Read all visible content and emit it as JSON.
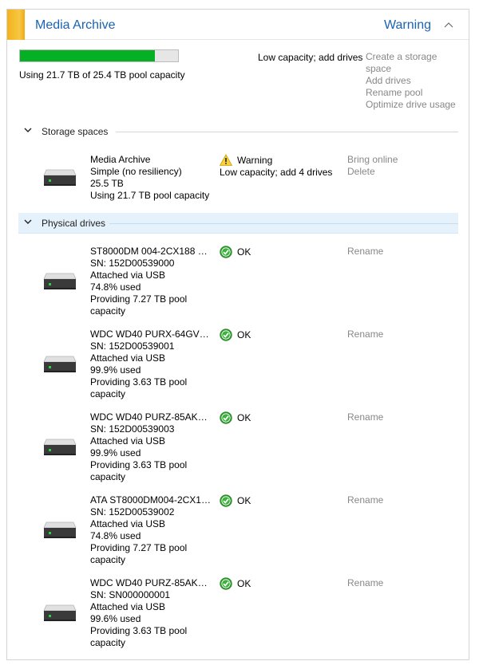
{
  "pool": {
    "title": "Media Archive",
    "status": "Warning",
    "collapse_glyph": "^",
    "usage_fraction": 0.855,
    "usage_text": "Using 21.7 TB of 25.4 TB pool capacity",
    "alert": "Low capacity; add drives",
    "tasks": [
      "Create a storage space",
      "Add drives",
      "Rename pool",
      "Optimize drive usage"
    ]
  },
  "sections": {
    "storage_spaces": "Storage spaces",
    "physical_drives": "Physical drives",
    "chevron_glyph": "⌄"
  },
  "storage_space": {
    "name": "Media Archive",
    "resiliency": "Simple (no resiliency)",
    "size": "25.5 TB",
    "usage": "Using 21.7 TB pool capacity",
    "status": "Warning",
    "status_detail": "Low capacity; add 4 drives",
    "actions": [
      "Bring online",
      "Delete"
    ]
  },
  "drives": [
    {
      "name": "ST8000DM 004-2CX188 SC...",
      "sn": "SN: 152D00539000",
      "attach": "Attached via USB",
      "used": "74.8% used",
      "providing": "Providing 7.27 TB pool capacity",
      "status": "OK",
      "action": "Rename"
    },
    {
      "name": "WDC WD40 PURX-64GVN...",
      "sn": "SN: 152D00539001",
      "attach": "Attached via USB",
      "used": "99.9% used",
      "providing": "Providing 3.63 TB pool capacity",
      "status": "OK",
      "action": "Rename"
    },
    {
      "name": "WDC WD40 PURZ-85AKK...",
      "sn": "SN: 152D00539003",
      "attach": "Attached via USB",
      "used": "99.9% used",
      "providing": "Providing 3.63 TB pool capacity",
      "status": "OK",
      "action": "Rename"
    },
    {
      "name": "ATA ST8000DM004-2CX1 S...",
      "sn": "SN: 152D00539002",
      "attach": "Attached via USB",
      "used": "74.8% used",
      "providing": "Providing 7.27 TB pool capacity",
      "status": "OK",
      "action": "Rename"
    },
    {
      "name": "WDC WD40 PURZ-85AKK...",
      "sn": "SN: SN000000001",
      "attach": "Attached via USB",
      "used": "99.6% used",
      "providing": "Providing 3.63 TB pool capacity",
      "status": "OK",
      "action": "Rename"
    }
  ],
  "colors": {
    "accent": "#1a63b4",
    "warning": "#f3b21b",
    "ok": "#2b9c2b",
    "usage_fill": "#06b025",
    "disabled_link": "#888888"
  },
  "icons": {
    "drive": "drive-icon",
    "ok": "ok-check-icon",
    "warning": "warning-triangle-icon",
    "chevron": "chevron-down-icon",
    "collapse": "chevron-up-icon"
  }
}
